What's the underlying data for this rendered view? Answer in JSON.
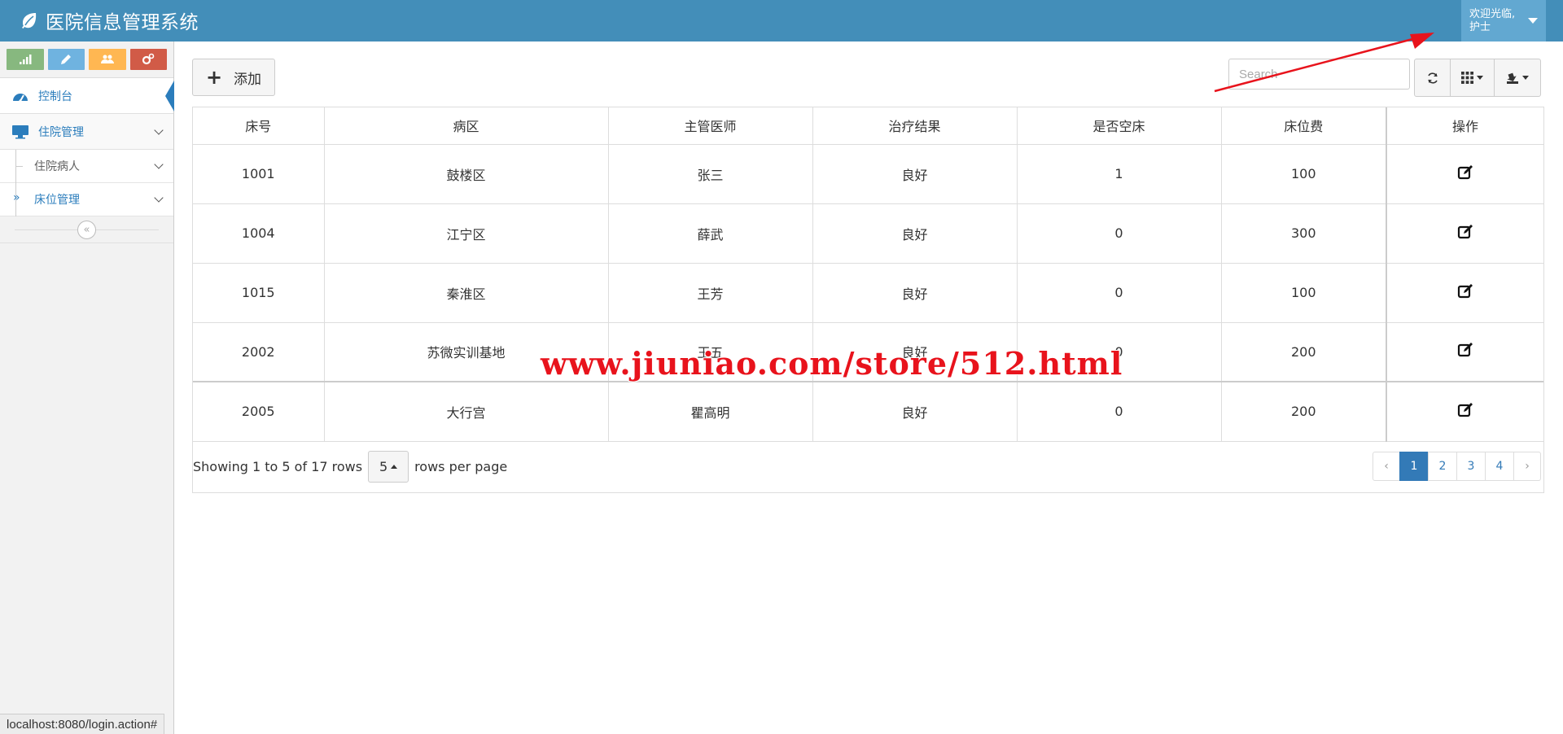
{
  "app": {
    "title": "医院信息管理系统",
    "user_greeting": "欢迎光临,",
    "user_role": "护士"
  },
  "sidebar": {
    "shortcuts": [
      {
        "icon": "signal-icon",
        "color": "#87b87f"
      },
      {
        "icon": "pencil-icon",
        "color": "#6fb3e0"
      },
      {
        "icon": "users-icon",
        "color": "#ffb752"
      },
      {
        "icon": "cogs-icon",
        "color": "#d15b47"
      }
    ],
    "items": [
      {
        "label": "控制台",
        "icon": "dashboard-icon",
        "active": true
      },
      {
        "label": "住院管理",
        "icon": "desktop-icon",
        "expanded": true,
        "children": [
          {
            "label": "住院病人"
          },
          {
            "label": "床位管理",
            "current": true
          }
        ]
      }
    ]
  },
  "toolbar": {
    "add_label": "添加",
    "search_placeholder": "Search"
  },
  "table": {
    "columns": [
      "床号",
      "病区",
      "主管医师",
      "治疗结果",
      "是否空床",
      "床位费",
      "操作"
    ],
    "rows": [
      [
        "1001",
        "鼓楼区",
        "张三",
        "良好",
        "1",
        "100"
      ],
      [
        "1004",
        "江宁区",
        "薛武",
        "良好",
        "0",
        "300"
      ],
      [
        "1015",
        "秦淮区",
        "王芳",
        "良好",
        "0",
        "100"
      ],
      [
        "2002",
        "苏微实训基地",
        "王五",
        "良好",
        "0",
        "200"
      ],
      [
        "2005",
        "大行宫",
        "瞿高明",
        "良好",
        "0",
        "200"
      ]
    ]
  },
  "pagination": {
    "showing_text": "Showing 1 to 5 of 17 rows",
    "page_size": "5",
    "per_page_text": "rows per page",
    "prev": "‹",
    "pages": [
      "1",
      "2",
      "3",
      "4"
    ],
    "next": "›",
    "current_page": "1"
  },
  "watermark": "www.jiuniao.com/store/512.html",
  "status_bar": {
    "url": "localhost:8080/login.action#"
  },
  "colors": {
    "navbar": "#438eb9",
    "user_menu": "#62a8d1",
    "accent": "#2b7dbc",
    "pagination_active": "#337ab7",
    "watermark": "#e8131c",
    "annotation_arrow": "#e8131c"
  }
}
